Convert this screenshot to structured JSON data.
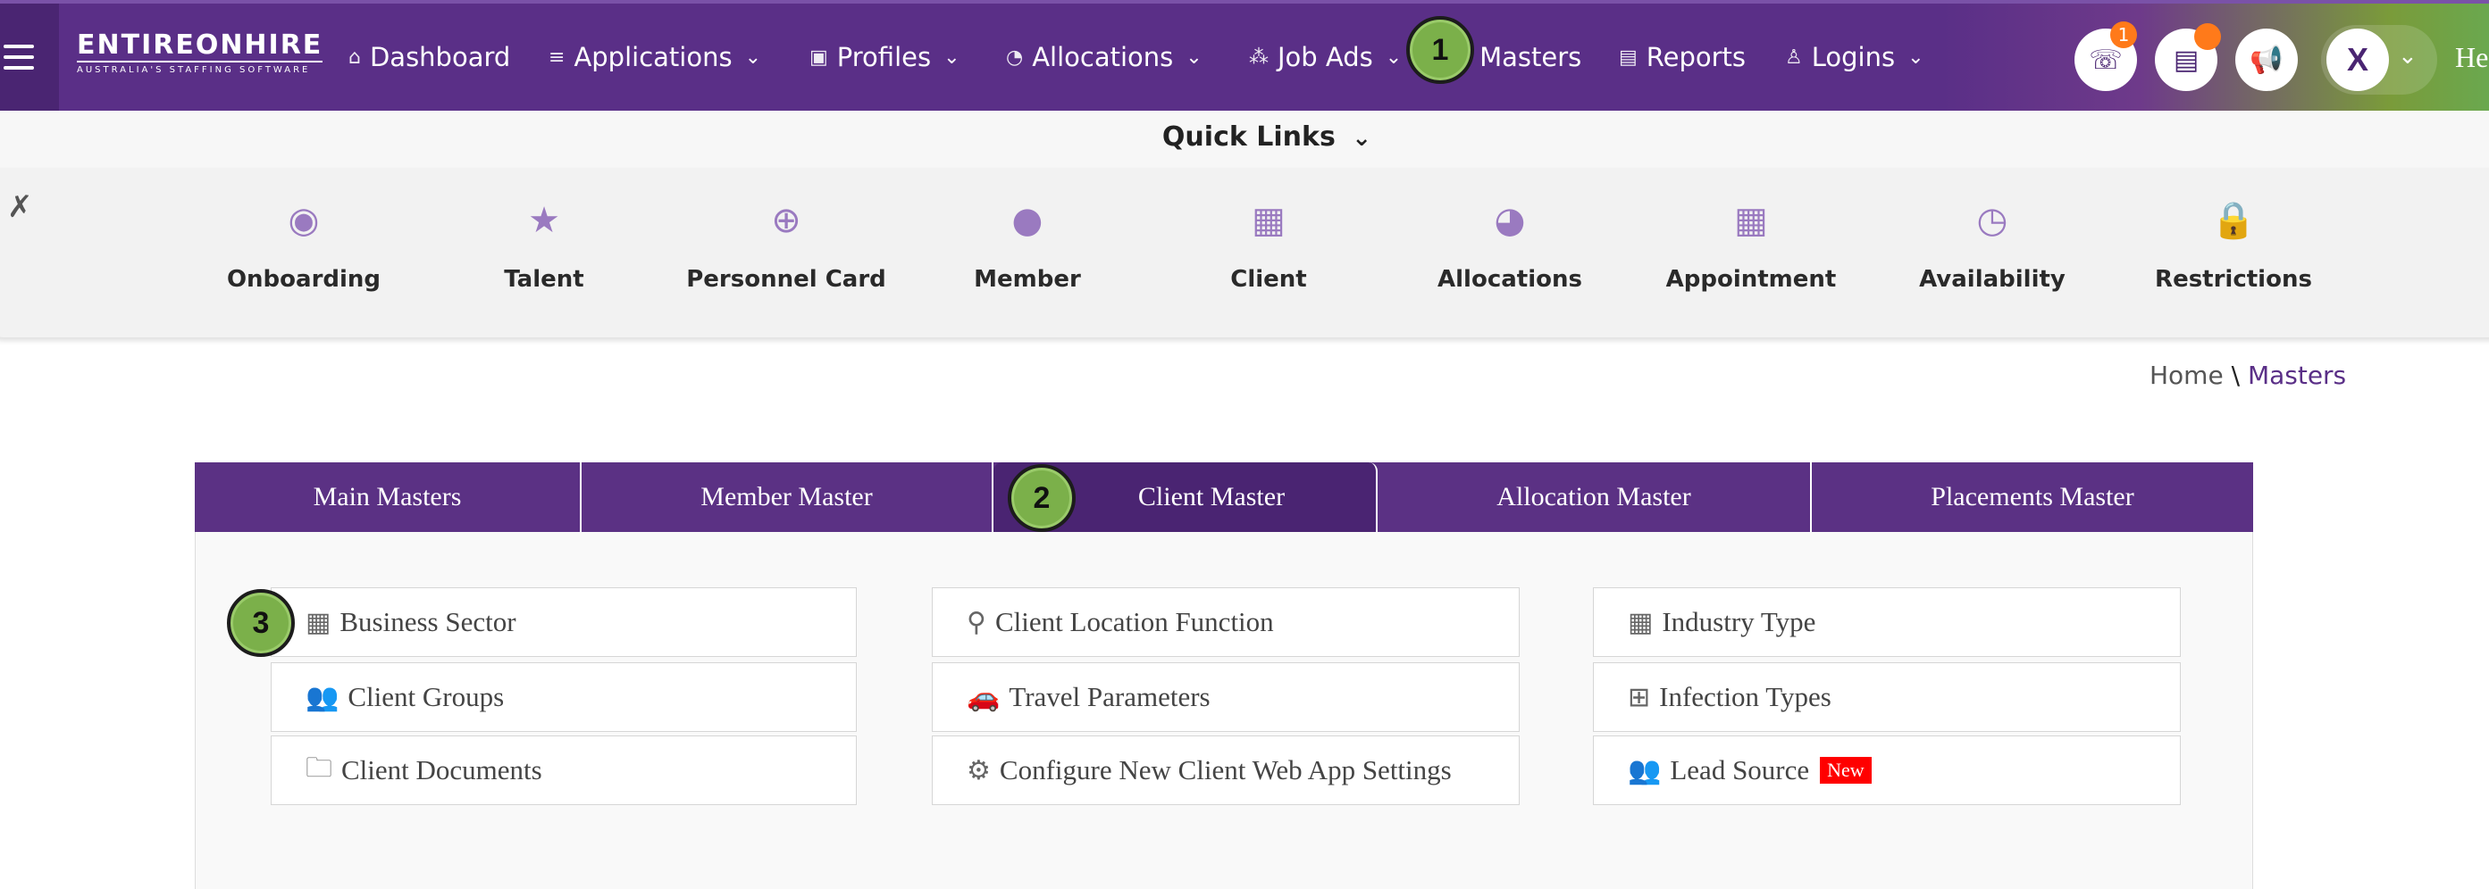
{
  "brand": {
    "name": "ENTIREONHIRE",
    "tagline": "AUSTRALIA'S STAFFING SOFTWARE"
  },
  "nav": {
    "items": [
      {
        "label": "Dashboard",
        "icon": "home-icon"
      },
      {
        "label": "Applications",
        "icon": "list-icon"
      },
      {
        "label": "Profiles",
        "icon": "id-card-icon"
      },
      {
        "label": "Allocations",
        "icon": "pie-icon"
      },
      {
        "label": "Job Ads",
        "icon": "network-icon"
      },
      {
        "label": "Masters",
        "icon": "doc-icon"
      },
      {
        "label": "Reports",
        "icon": "doc-icon"
      },
      {
        "label": "Logins",
        "icon": "user-icon"
      }
    ],
    "call_badge": "1",
    "avatar_initial": "X",
    "greeting": "He"
  },
  "quick_links": {
    "title": "Quick Links",
    "items": [
      {
        "label": "Onboarding",
        "icon": "user-circle-icon"
      },
      {
        "label": "Talent",
        "icon": "star-icon"
      },
      {
        "label": "Personnel Card",
        "icon": "search-plus-icon"
      },
      {
        "label": "Member",
        "icon": "person-icon"
      },
      {
        "label": "Client",
        "icon": "building-icon"
      },
      {
        "label": "Allocations",
        "icon": "pie-icon"
      },
      {
        "label": "Appointment",
        "icon": "calendar-icon"
      },
      {
        "label": "Availability",
        "icon": "clock-icon"
      },
      {
        "label": "Restrictions",
        "icon": "lock-icon"
      }
    ]
  },
  "breadcrumb": {
    "home": "Home",
    "separator": "\\",
    "current": "Masters"
  },
  "tabs": [
    {
      "label": "Main Masters"
    },
    {
      "label": "Member Master"
    },
    {
      "label": "Client Master",
      "active": true
    },
    {
      "label": "Allocation Master"
    },
    {
      "label": "Placements Master"
    }
  ],
  "cards": [
    {
      "label": "Business Sector",
      "icon": "building-icon"
    },
    {
      "label": "Client Groups",
      "icon": "users-icon"
    },
    {
      "label": "Client Documents",
      "icon": "folder-icon"
    },
    {
      "label": "Client Location Function",
      "icon": "map-pin-icon"
    },
    {
      "label": "Travel Parameters",
      "icon": "car-icon"
    },
    {
      "label": "Configure New Client Web App Settings",
      "icon": "gear-icon"
    },
    {
      "label": "Industry Type",
      "icon": "building-icon"
    },
    {
      "label": "Infection Types",
      "icon": "medkit-icon"
    },
    {
      "label": "Lead Source",
      "icon": "users-icon",
      "badge": "New"
    }
  ],
  "steps": [
    "1",
    "2",
    "3"
  ],
  "colors": {
    "primary": "#5b3184",
    "active_tab": "#4a2472",
    "quick_icon": "#9a7ac0",
    "step": "#7bb04a",
    "new_badge": "#ff0000",
    "notif": "#ff7a1a"
  }
}
